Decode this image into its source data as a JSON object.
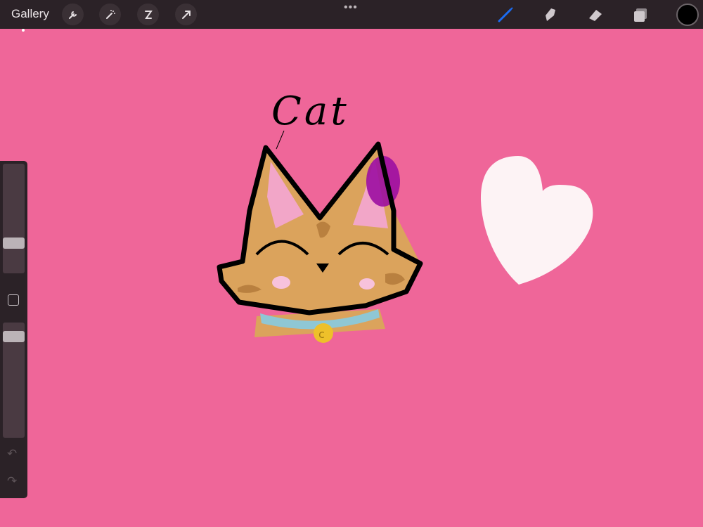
{
  "app": {
    "gallery_label": "Gallery",
    "more_label": "•••"
  },
  "toolbar_left": [
    {
      "name": "wrench-icon"
    },
    {
      "name": "magic-wand-icon"
    },
    {
      "name": "selection-icon"
    },
    {
      "name": "transform-arrow-icon"
    }
  ],
  "toolbar_right": [
    {
      "name": "brush-icon",
      "active": true
    },
    {
      "name": "smudge-icon"
    },
    {
      "name": "eraser-icon"
    },
    {
      "name": "layers-icon"
    }
  ],
  "colors": {
    "canvas": "#EF6699",
    "toolbar": "#2b2227",
    "active_tool": "#1b6cf2",
    "current_color": "#000000"
  },
  "sidebar": {
    "brush_size_level": 0.25,
    "opacity_level": 0.92,
    "undo_icon": "↶",
    "redo_icon": "↷"
  },
  "canvas_text": {
    "label": "Cat"
  }
}
